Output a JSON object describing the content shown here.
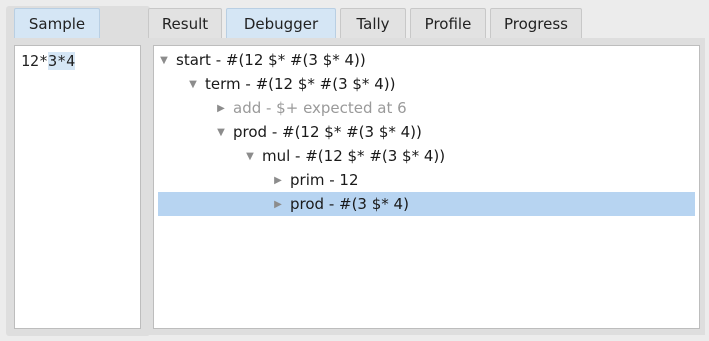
{
  "left_tab": {
    "label": "Sample"
  },
  "tabs": [
    {
      "label": "Result"
    },
    {
      "label": "Debugger"
    },
    {
      "label": "Tally"
    },
    {
      "label": "Profile"
    },
    {
      "label": "Progress"
    }
  ],
  "sample": {
    "prefix": "12*",
    "selected": "3*4"
  },
  "tree": [
    {
      "label": "start - #(12 $* #(3 $* 4))",
      "expanded": true
    },
    {
      "label": "term - #(12 $* #(3 $* 4))",
      "expanded": true
    },
    {
      "label": "add - $+ expected at 6",
      "expanded": false,
      "dim": true
    },
    {
      "label": "prod - #(12 $* #(3 $* 4))",
      "expanded": true
    },
    {
      "label": "mul - #(12 $* #(3 $* 4))",
      "expanded": true
    },
    {
      "label": "prim - 12",
      "expanded": false
    },
    {
      "label": "prod - #(3 $* 4)",
      "expanded": false,
      "selected": true
    }
  ],
  "icons": {
    "expanded": "triangle-down-icon",
    "collapsed": "triangle-right-icon"
  }
}
